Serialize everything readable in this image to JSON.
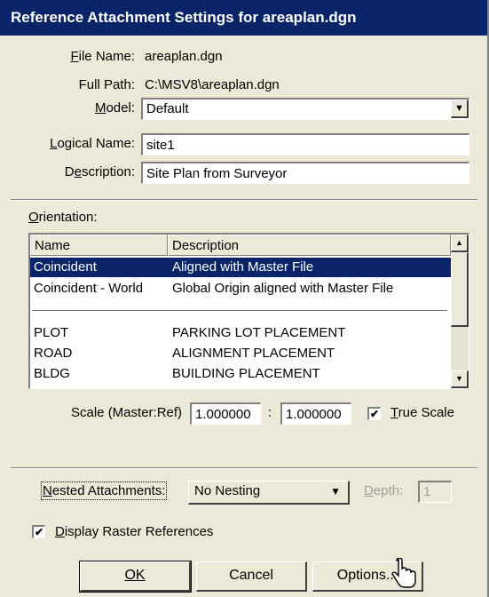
{
  "dialog": {
    "title": "Reference Attachment Settings for areaplan.dgn"
  },
  "file": {
    "file_name_label": "File Name:",
    "file_name_value": "areaplan.dgn",
    "full_path_label": "Full Path:",
    "full_path_value": "C:\\MSV8\\areaplan.dgn",
    "model_label": "Model:",
    "model_value": "Default",
    "logical_name_label": "Logical Name:",
    "logical_name_value": "site1",
    "description_label": "Description:",
    "description_value": "Site Plan from Surveyor"
  },
  "orientation": {
    "label": "Orientation:",
    "columns": [
      "Name",
      "Description"
    ],
    "rows": [
      {
        "name": "Coincident",
        "description": "Aligned with Master File",
        "selected": true
      },
      {
        "name": "Coincident - World",
        "description": "Global Origin aligned with Master File",
        "selected": false
      },
      {
        "name": "PLOT",
        "description": "PARKING LOT PLACEMENT",
        "selected": false
      },
      {
        "name": "ROAD",
        "description": "ALIGNMENT PLACEMENT",
        "selected": false
      },
      {
        "name": "BLDG",
        "description": "BUILDING PLACEMENT",
        "selected": false
      }
    ]
  },
  "scale": {
    "label": "Scale (Master:Ref)",
    "master_value": "1.000000",
    "separator": ":",
    "ref_value": "1.000000",
    "true_scale_label": "True Scale",
    "true_scale_checked": true
  },
  "nesting": {
    "label": "Nested Attachments:",
    "value": "No Nesting",
    "depth_label": "Depth:",
    "depth_value": "1"
  },
  "raster": {
    "label": "Display Raster References",
    "checked": true
  },
  "buttons": {
    "ok": "OK",
    "cancel": "Cancel",
    "options": "Options..."
  },
  "colors": {
    "title_bar": "#0a246a",
    "selection": "#0a246a",
    "face": "#ece9d8"
  },
  "icons": {
    "dropdown": "chevron-down-icon",
    "scroll_up": "arrow-up-icon",
    "scroll_down": "arrow-down-icon",
    "check": "checkmark-icon",
    "cursor": "hand-pointer-icon"
  }
}
